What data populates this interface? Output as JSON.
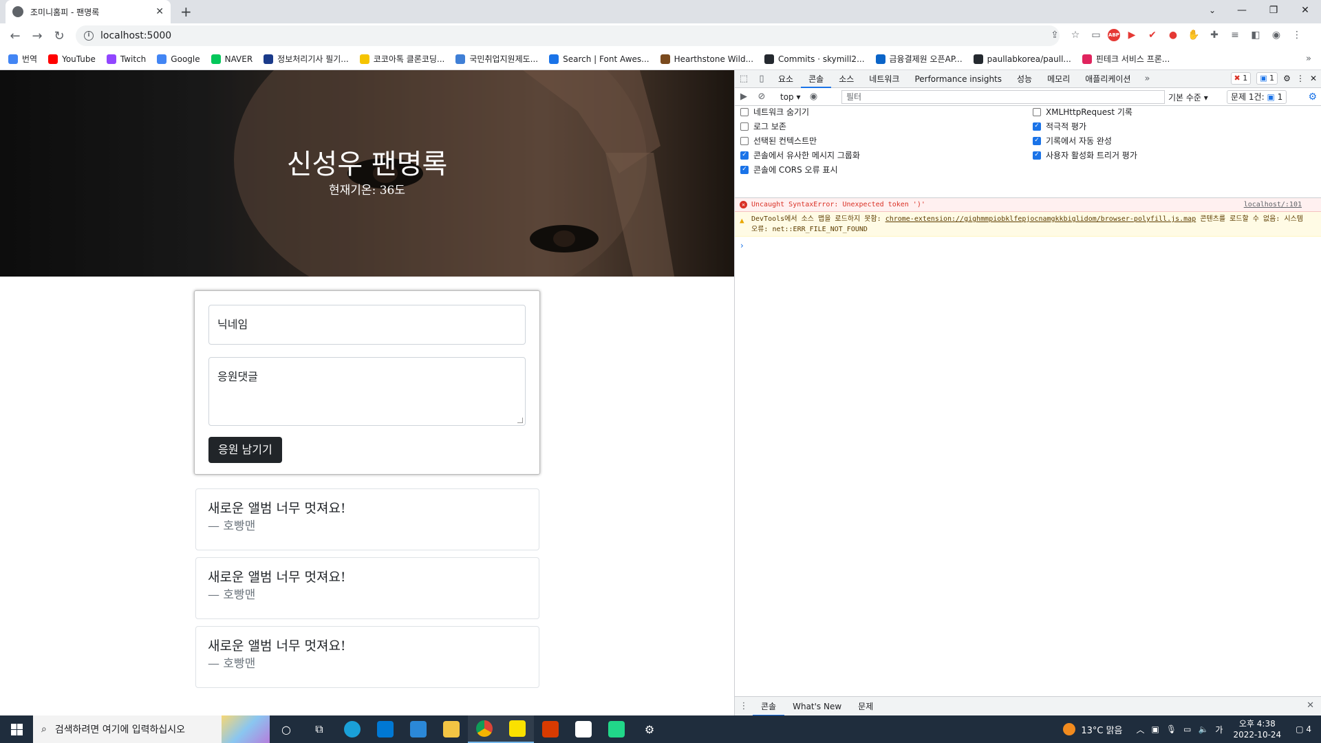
{
  "browser": {
    "tab_title": "조미니홈피 - 팬명록",
    "url": "localhost:5000",
    "new_tab": "+",
    "bookmarks": [
      {
        "label": "번역",
        "color": "#4285f4"
      },
      {
        "label": "YouTube",
        "color": "#ff0000"
      },
      {
        "label": "Twitch",
        "color": "#9146ff"
      },
      {
        "label": "Google",
        "color": "#4285f4"
      },
      {
        "label": "NAVER",
        "color": "#03c75a"
      },
      {
        "label": "정보처리기사 필기...",
        "color": "#1a3a8a"
      },
      {
        "label": "코코아톡 클론코딩...",
        "color": "#f5c400"
      },
      {
        "label": "국민취업지원제도...",
        "color": "#3f7fd6"
      },
      {
        "label": "Search | Font Awes...",
        "color": "#1a73e8"
      },
      {
        "label": "Hearthstone Wild...",
        "color": "#7a4a1e"
      },
      {
        "label": "Commits · skymill2...",
        "color": "#24292f"
      },
      {
        "label": "금융결제원 오픈AP...",
        "color": "#0a64c8"
      },
      {
        "label": "paullabkorea/paull...",
        "color": "#24292f"
      },
      {
        "label": "핀테크 서비스 프론...",
        "color": "#e0245e"
      }
    ]
  },
  "page": {
    "hero_title": "신성우 팬명록",
    "hero_temp": "현재기온: 36도",
    "nickname_placeholder": "닉네임",
    "comment_placeholder": "응원댓글",
    "submit_label": "응원 남기기",
    "cards": [
      {
        "message": "새로운 앨범 너무 멋져요!",
        "author": "— 호빵맨"
      },
      {
        "message": "새로운 앨범 너무 멋져요!",
        "author": "— 호빵맨"
      },
      {
        "message": "새로운 앨범 너무 멋져요!",
        "author": "— 호빵맨"
      }
    ]
  },
  "devtools": {
    "tabs": [
      "요소",
      "콘솔",
      "소스",
      "네트워크",
      "Performance insights",
      "성능",
      "메모리",
      "애플리케이션"
    ],
    "active_tab": "콘솔",
    "error_badge": "1",
    "message_badge": "1",
    "context": "top ▾",
    "filter_placeholder": "필터",
    "levels": "기본 수준 ▾",
    "issues_label": "문제 1건:",
    "issues_count": "1",
    "settings_left": [
      {
        "label": "네트워크 숨기기",
        "checked": false
      },
      {
        "label": "로그 보존",
        "checked": false
      },
      {
        "label": "선택된 컨텍스트만",
        "checked": false
      },
      {
        "label": "콘솔에서 유사한 메시지 그룹화",
        "checked": true
      },
      {
        "label": "콘솔에 CORS 오류 표시",
        "checked": true
      }
    ],
    "settings_right": [
      {
        "label": "XMLHttpRequest 기록",
        "checked": false
      },
      {
        "label": "적극적 평가",
        "checked": true
      },
      {
        "label": "기록에서 자동 완성",
        "checked": true
      },
      {
        "label": "사용자 활성화 트리거 평가",
        "checked": true
      }
    ],
    "error_text": "Uncaught SyntaxError: Unexpected token ')'",
    "error_source": "localhost/:101",
    "warn_prefix": "DevTools에서 소스 맵을 로드하지 못함: ",
    "warn_link": "chrome-extension://gighmmpiobklfepjocnamgkkbiglidom/browser-polyfill.js.map",
    "warn_suffix": " 콘텐츠를 로드할 수 없음: 시스템 오류: net::ERR_FILE_NOT_FOUND",
    "drawer_tabs": [
      "콘솔",
      "What's New",
      "문제"
    ]
  },
  "taskbar": {
    "search_placeholder": "검색하려면 여기에 입력하십시오",
    "weather": "13°C 맑음",
    "ime": "가",
    "time": "오후 4:38",
    "date": "2022-10-24",
    "notifications": "4"
  }
}
